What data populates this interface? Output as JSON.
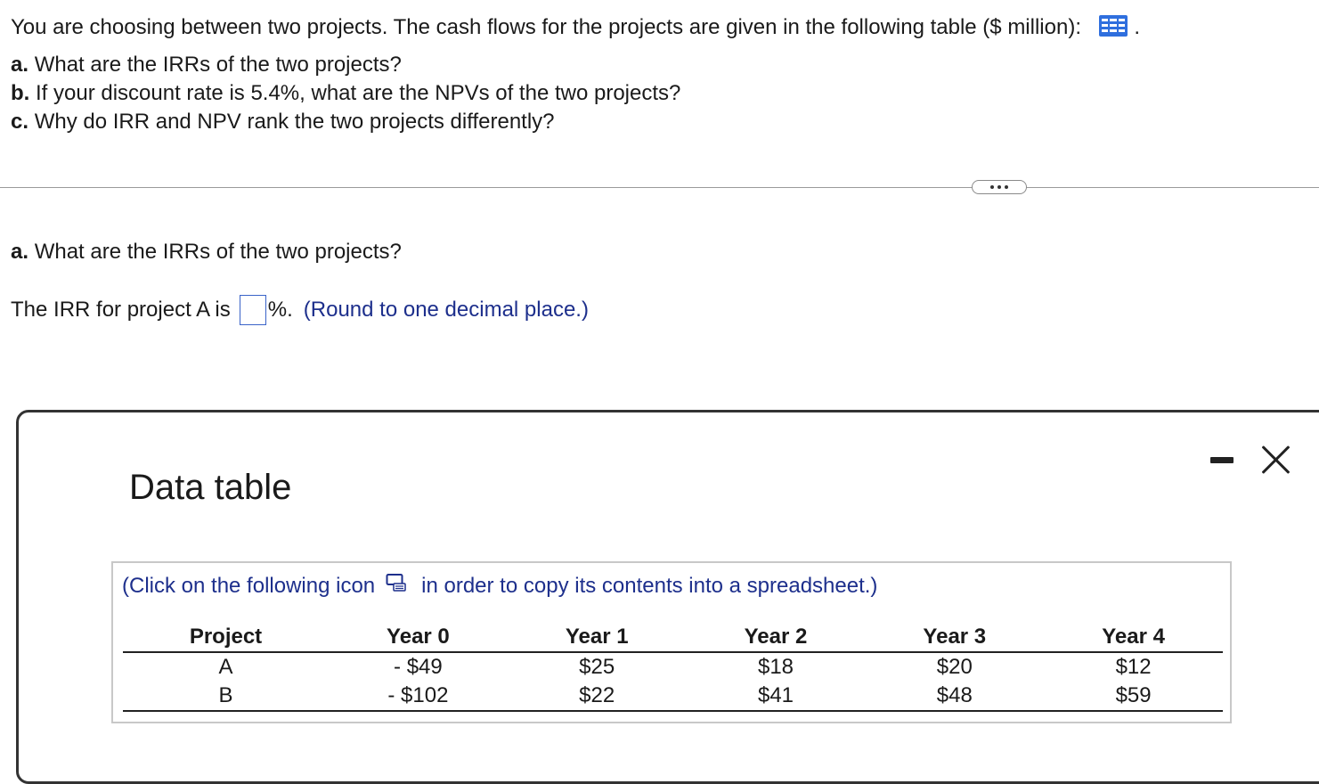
{
  "question": {
    "intro": "You are choosing between two projects. The cash flows for the projects are given in the following table ($ million):",
    "intro_end": ".",
    "parts": [
      {
        "label": "a.",
        "text": "What are the IRRs of the two projects?"
      },
      {
        "label": "b.",
        "text": "If your discount rate is 5.4%, what are the NPVs of the two projects?"
      },
      {
        "label": "c.",
        "text": "Why do IRR and NPV rank the two projects differently?"
      }
    ]
  },
  "answer_section": {
    "part_label": "a.",
    "part_text": "What are the IRRs of the two projects?",
    "irr_prefix": "The IRR for project A is",
    "irr_value": "",
    "irr_suffix": "%.",
    "hint": "(Round to one decimal place.)"
  },
  "data_table": {
    "title": "Data table",
    "copy_hint_before": "(Click on the following icon",
    "copy_hint_after": "in order to copy its contents into a spreadsheet.)",
    "headers": [
      "Project",
      "Year 0",
      "Year 1",
      "Year 2",
      "Year 3",
      "Year 4"
    ],
    "rows": [
      [
        "A",
        "- $49",
        "$25",
        "$18",
        "$20",
        "$12"
      ],
      [
        "B",
        "- $102",
        "$22",
        "$41",
        "$48",
        "$59"
      ]
    ]
  },
  "colors": {
    "accent_blue": "#3a63c8",
    "hint_text": "#1d2f8c",
    "grid_icon": "#2f6fde"
  },
  "icons": [
    "table-grid-icon",
    "more-dots-icon",
    "copy-spreadsheet-icon",
    "minimize-icon",
    "close-icon"
  ]
}
